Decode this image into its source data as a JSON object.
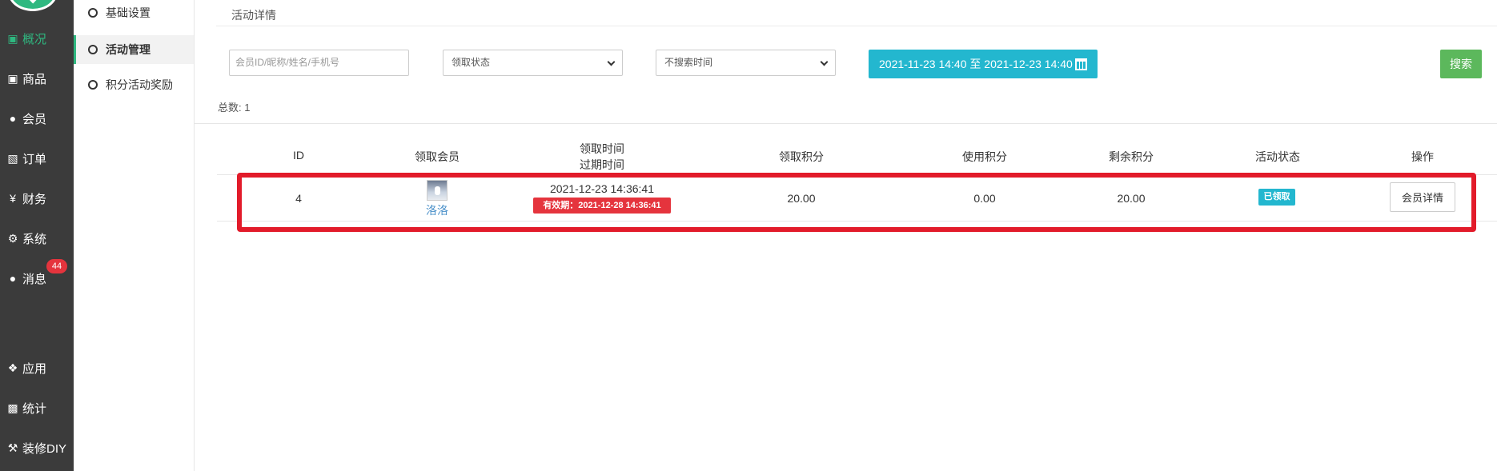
{
  "sidebar": {
    "items": [
      {
        "label": "概况",
        "icon": "dashboard-icon",
        "active": true
      },
      {
        "label": "商品",
        "icon": "product-icon",
        "active": false
      },
      {
        "label": "会员",
        "icon": "members-icon",
        "active": false
      },
      {
        "label": "订单",
        "icon": "cart-icon",
        "active": false
      },
      {
        "label": "财务",
        "icon": "yen-icon",
        "active": false
      },
      {
        "label": "系统",
        "icon": "cogs-icon",
        "active": false
      },
      {
        "label": "消息",
        "icon": "chat-icon",
        "active": false
      },
      {
        "label": "应用",
        "icon": "apps-icon",
        "active": false
      },
      {
        "label": "统计",
        "icon": "bar-chart-icon",
        "active": false
      },
      {
        "label": "装修DIY",
        "icon": "hammer-icon",
        "active": false
      }
    ],
    "message_badge": "44"
  },
  "submenu": {
    "items": [
      {
        "label": "基础设置",
        "active": false
      },
      {
        "label": "活动管理",
        "active": true
      },
      {
        "label": "积分活动奖励",
        "active": false
      }
    ]
  },
  "page": {
    "title": "活动详情"
  },
  "filters": {
    "member_search_placeholder": "会员ID/昵称/姓名/手机号",
    "claim_status_selected": "领取状态",
    "time_filter_selected": "不搜索时间",
    "date_range": "2021-11-23 14:40 至 2021-12-23 14:40",
    "search_label": "搜索"
  },
  "summary": {
    "total_label": "总数:",
    "total_value": "1"
  },
  "table": {
    "headers": {
      "id": "ID",
      "member": "领取会员",
      "claim_time": "领取时间",
      "expire_time": "过期时间",
      "claimed_points": "领取积分",
      "used_points": "使用积分",
      "remaining_points": "剩余积分",
      "status": "活动状态",
      "actions": "操作"
    },
    "rows": [
      {
        "id": "4",
        "member_name": "洛洛",
        "claim_time": "2021-12-23 14:36:41",
        "validity": "有效期：2021-12-28 14:36:41",
        "claimed_points": "20.00",
        "used_points": "0.00",
        "remaining_points": "20.00",
        "status": "已领取",
        "action_label": "会员详情"
      }
    ]
  },
  "colors": {
    "sidebar_bg": "#3b3b3b",
    "accent_green": "#2fb880",
    "cyan": "#23b7cf",
    "search_green": "#5cb85c",
    "highlight_red": "#e21b2a",
    "tag_red": "#e5343d"
  }
}
